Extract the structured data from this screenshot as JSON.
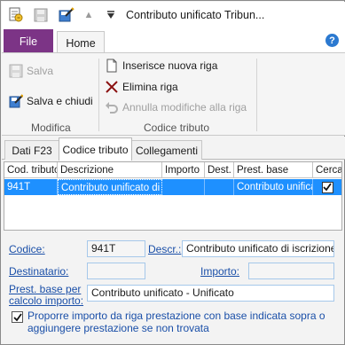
{
  "window": {
    "title": "Contributo unificato Tribun..."
  },
  "ribbon": {
    "tabs": {
      "file": "File",
      "home": "Home"
    },
    "help_label": "?",
    "groups": {
      "modifica": {
        "label": "Modifica",
        "salva": "Salva",
        "salva_chiudi": "Salva e chiudi"
      },
      "codice_tributo": {
        "label": "Codice tributo",
        "inserisci": "Inserisce nuova riga",
        "elimina": "Elimina riga",
        "annulla": "Annulla modifiche alla riga"
      }
    }
  },
  "content_tabs": [
    "Dati F23",
    "Codice tributo",
    "Collegamenti"
  ],
  "grid": {
    "columns": [
      "Cod. tributo",
      "Descrizione",
      "Importo",
      "Dest.",
      "Prest. base",
      "Cerca"
    ],
    "rows": [
      {
        "cod_tributo": "941T",
        "descrizione": "Contributo unificato di iscrizione a ruolo",
        "importo": "",
        "dest": "",
        "prest_base": "Contributo unificato",
        "cerca": true
      }
    ]
  },
  "detail": {
    "codice_label": "Codice:",
    "codice_value": "941T",
    "descr_label": "Descr.:",
    "descr_value": "Contributo unificato di iscrizione a ruolo",
    "destinatario_label": "Destinatario:",
    "destinatario_value": "",
    "importo_label": "Importo:",
    "importo_value": "",
    "prest_base_label_1": "Prest. base per",
    "prest_base_label_2": "calcolo importo:",
    "prest_base_value": "Contributo unificato - Unificato",
    "proporre_checked": true,
    "proporre_label_1": "Proporre importo da riga prestazione con base indicata sopra o",
    "proporre_label_2": "aggiungere prestazione se non trovata"
  },
  "colors": {
    "file_tab": "#7c3486",
    "selection": "#1e90ff",
    "help": "#2b79d0"
  }
}
